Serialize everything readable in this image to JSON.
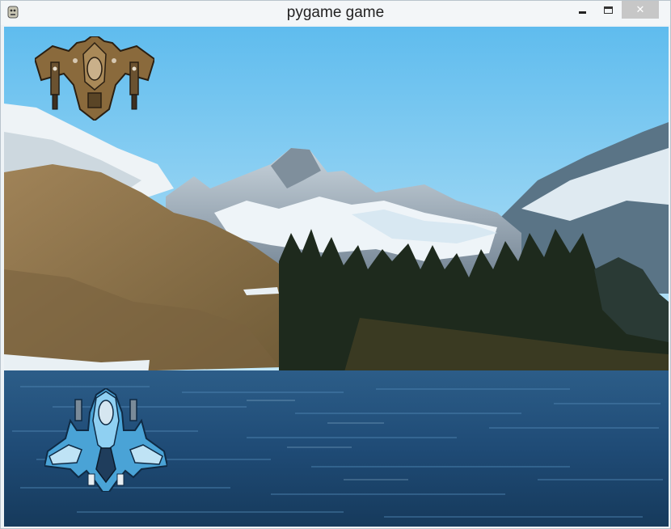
{
  "window": {
    "title": "pygame game",
    "app_icon": "pygame-icon",
    "controls": {
      "minimize_icon": "minimize-icon",
      "maximize_icon": "maximize-icon",
      "close_icon": "close-icon",
      "close_glyph": "✕"
    }
  },
  "game": {
    "background": "mountain-lake-scenery",
    "enemy": {
      "icon": "enemy-plane-icon",
      "color": "#8a6a3c"
    },
    "player": {
      "icon": "player-plane-icon",
      "color": "#4aa3d6"
    }
  },
  "colors": {
    "sky_top": "#6cc4f0",
    "sky_bottom": "#bfe6f8",
    "lake": "#1f4a73",
    "hill": "#8e7347",
    "forest": "#1e2a1c",
    "snow": "#e8f0f4"
  }
}
